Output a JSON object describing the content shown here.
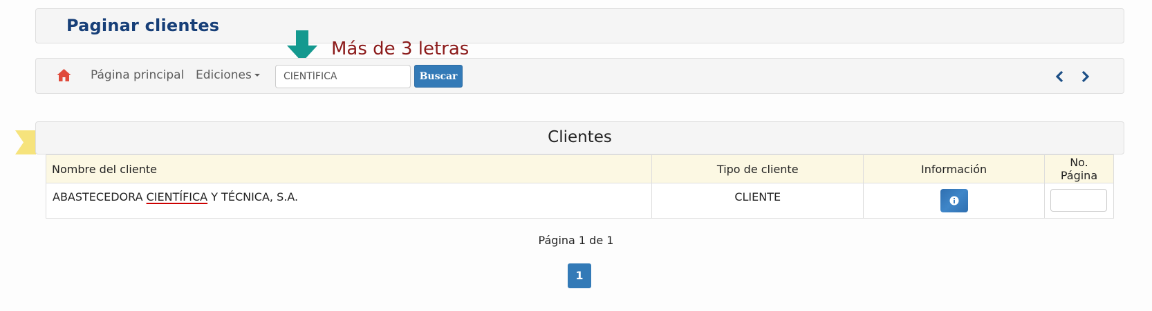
{
  "page": {
    "title": "Paginar clientes",
    "hint": "Más de 3 letras"
  },
  "navbar": {
    "home_icon": "home-icon",
    "home_label": "Página principal",
    "ediciones_label": "Ediciones",
    "search": {
      "value": "CIENTÍFICA",
      "button_label": "Buscar"
    },
    "prev_icon": "chevron-left-icon",
    "next_icon": "chevron-right-icon"
  },
  "clients": {
    "title": "Clientes",
    "columns": [
      "Nombre del cliente",
      "Tipo de cliente",
      "Información",
      "No. Página"
    ],
    "rows": [
      {
        "name_before": "ABASTECEDORA ",
        "name_match": "CIENTÍFICA",
        "name_after": " Y TÉCNICA, S.A.",
        "type": "CLIENTE",
        "info_icon": "info-icon",
        "page_number_value": ""
      }
    ]
  },
  "pagination": {
    "info": "Página 1 de 1",
    "pages": [
      "1"
    ]
  },
  "colors": {
    "title": "#173f78",
    "hint": "#8b1a1a",
    "hint_arrow": "#14998f",
    "primary": "#337ab7",
    "home_icon": "#e04a3b",
    "table_header_bg": "#fcf8e3",
    "ribbon": "#f6e37c"
  }
}
